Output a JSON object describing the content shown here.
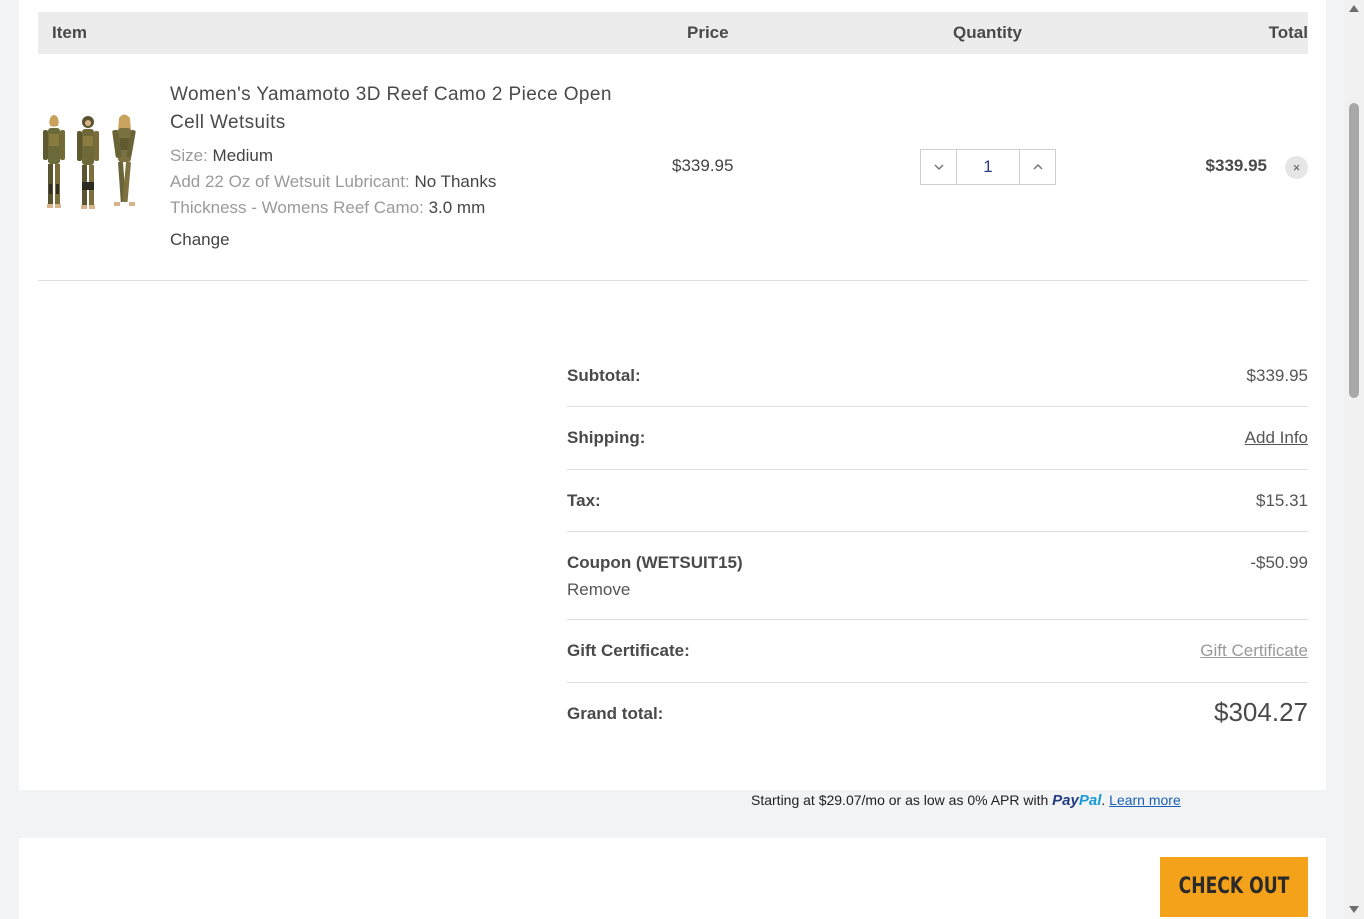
{
  "table_header": {
    "item": "Item",
    "price": "Price",
    "quantity": "Quantity",
    "total": "Total"
  },
  "cart_item": {
    "name": "Women's Yamamoto 3D Reef Camo 2 Piece Open Cell Wetsuits",
    "options": [
      {
        "label": "Size:",
        "value": "Medium"
      },
      {
        "label": "Add 22 Oz of Wetsuit Lubricant:",
        "value": "No Thanks"
      },
      {
        "label": "Thickness - Womens Reef Camo:",
        "value": "3.0 mm"
      }
    ],
    "change_label": "Change",
    "price": "$339.95",
    "quantity": "1",
    "total": "$339.95",
    "remove_glyph": "×",
    "thumbnail_icon": "wetsuit-product-image"
  },
  "summary": {
    "subtotal": {
      "label": "Subtotal:",
      "value": "$339.95"
    },
    "shipping": {
      "label": "Shipping:",
      "value": "Add Info"
    },
    "tax": {
      "label": "Tax:",
      "value": "$15.31"
    },
    "coupon": {
      "label": "Coupon (WETSUIT15)",
      "value": "-$50.99",
      "remove_label": "Remove"
    },
    "gift": {
      "label": "Gift Certificate:",
      "value": "Gift Certificate"
    },
    "grand_total": {
      "label": "Grand total:",
      "value": "$304.27"
    }
  },
  "paypal": {
    "text": "Starting at $29.07/mo or as low as 0% APR with",
    "logo_part1": "Pay",
    "logo_part2": "Pal",
    "period": ".",
    "learn_more": "Learn more"
  },
  "checkout_label": "CHECK OUT",
  "colors": {
    "accent": "#f5a21b",
    "paypal_dark": "#253b80",
    "paypal_light": "#179bd7",
    "link": "#1a5fb4"
  }
}
